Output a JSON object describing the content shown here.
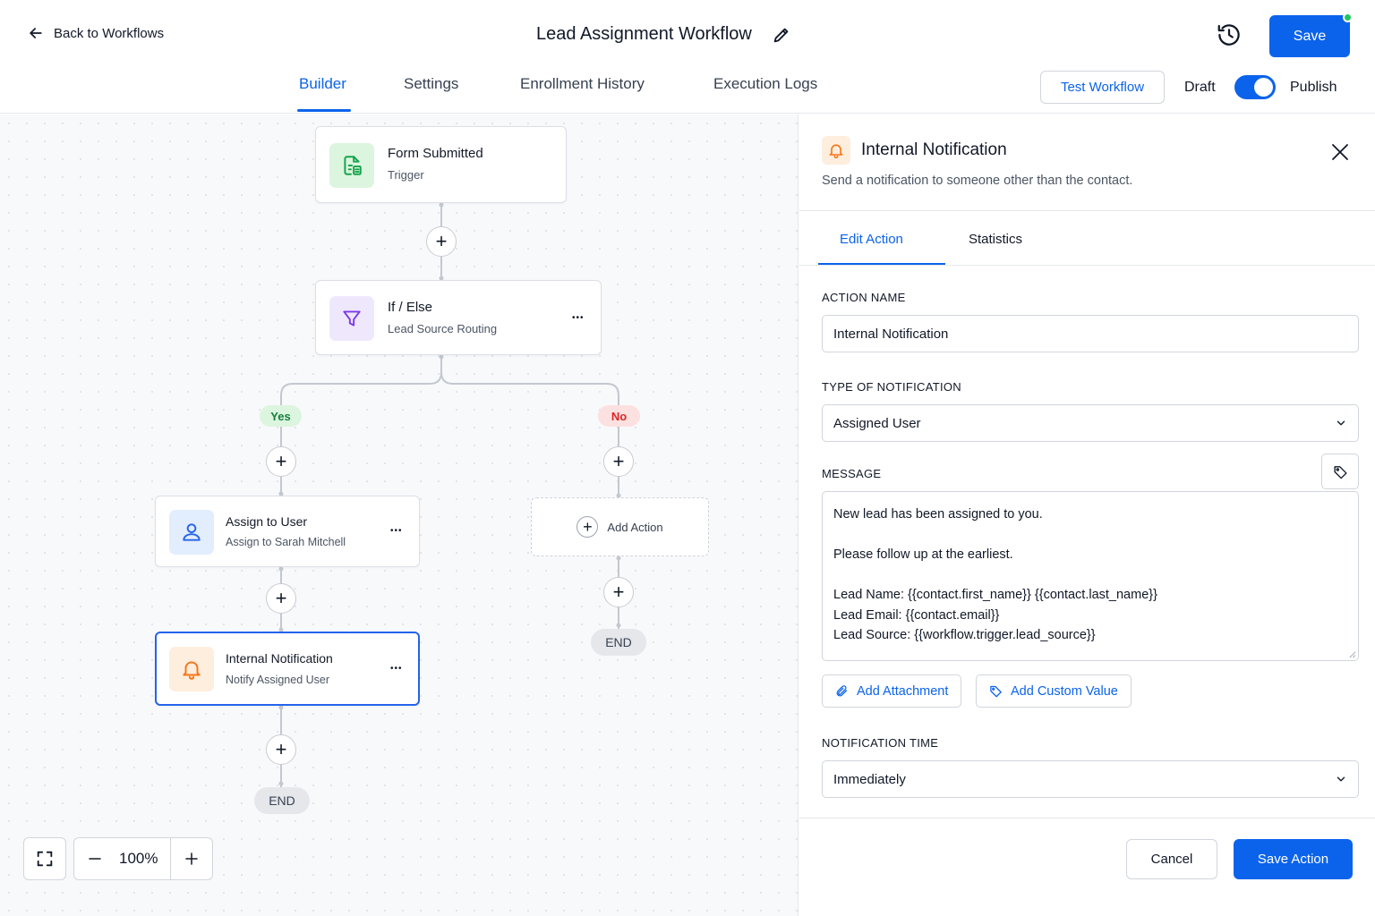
{
  "header": {
    "back_label": "Back to Workflows",
    "title": "Lead Assignment Workflow",
    "save_label": "Save",
    "status_dot_color": "#22c55e",
    "accent_color": "#0b63ec"
  },
  "tabs": [
    {
      "label": "Builder",
      "active": true
    },
    {
      "label": "Settings",
      "active": false
    },
    {
      "label": "Enrollment History",
      "active": false
    },
    {
      "label": "Execution Logs",
      "active": false
    }
  ],
  "toolbar": {
    "test_label": "Test Workflow",
    "draft_label": "Draft",
    "publish_label": "Publish",
    "published": true
  },
  "canvas": {
    "trigger": {
      "title": "Form Submitted",
      "subtitle": "Trigger",
      "icon": "form-icon"
    },
    "condition": {
      "title": "If / Else",
      "subtitle": "Lead Source Routing",
      "icon": "filter-icon"
    },
    "yes_label": "Yes",
    "no_label": "No",
    "assign": {
      "title": "Assign to User",
      "subtitle": "Assign to Sarah Mitchell",
      "icon": "user-icon"
    },
    "notify": {
      "title": "Internal Notification",
      "subtitle": "Notify Assigned User",
      "icon": "bell-icon"
    },
    "add_action_label": "Add Action",
    "end_label": "END",
    "plus_glyph": "+",
    "more_glyph": "•••",
    "zoom_level": "100%"
  },
  "panel": {
    "title": "Internal Notification",
    "description": "Send a notification to someone other than the contact.",
    "tabs": [
      {
        "label": "Edit Action",
        "active": true
      },
      {
        "label": "Statistics",
        "active": false
      }
    ],
    "action_name_label": "ACTION NAME",
    "action_name_value": "Internal Notification",
    "type_label": "TYPE OF NOTIFICATION",
    "type_value": "Assigned User",
    "message_label": "MESSAGE",
    "message_lines": [
      "New lead has been assigned to you.",
      "",
      "Please follow up at the earliest.",
      "",
      "Lead Name: {{contact.first_name}} {{contact.last_name}}",
      "Lead Email: {{contact.email}}",
      "Lead Source: {{workflow.trigger.lead_source}}"
    ],
    "add_attachment_label": "Add Attachment",
    "add_custom_value_label": "Add Custom Value",
    "time_label": "NOTIFICATION TIME",
    "time_value": "Immediately",
    "cancel_label": "Cancel",
    "save_action_label": "Save Action"
  }
}
